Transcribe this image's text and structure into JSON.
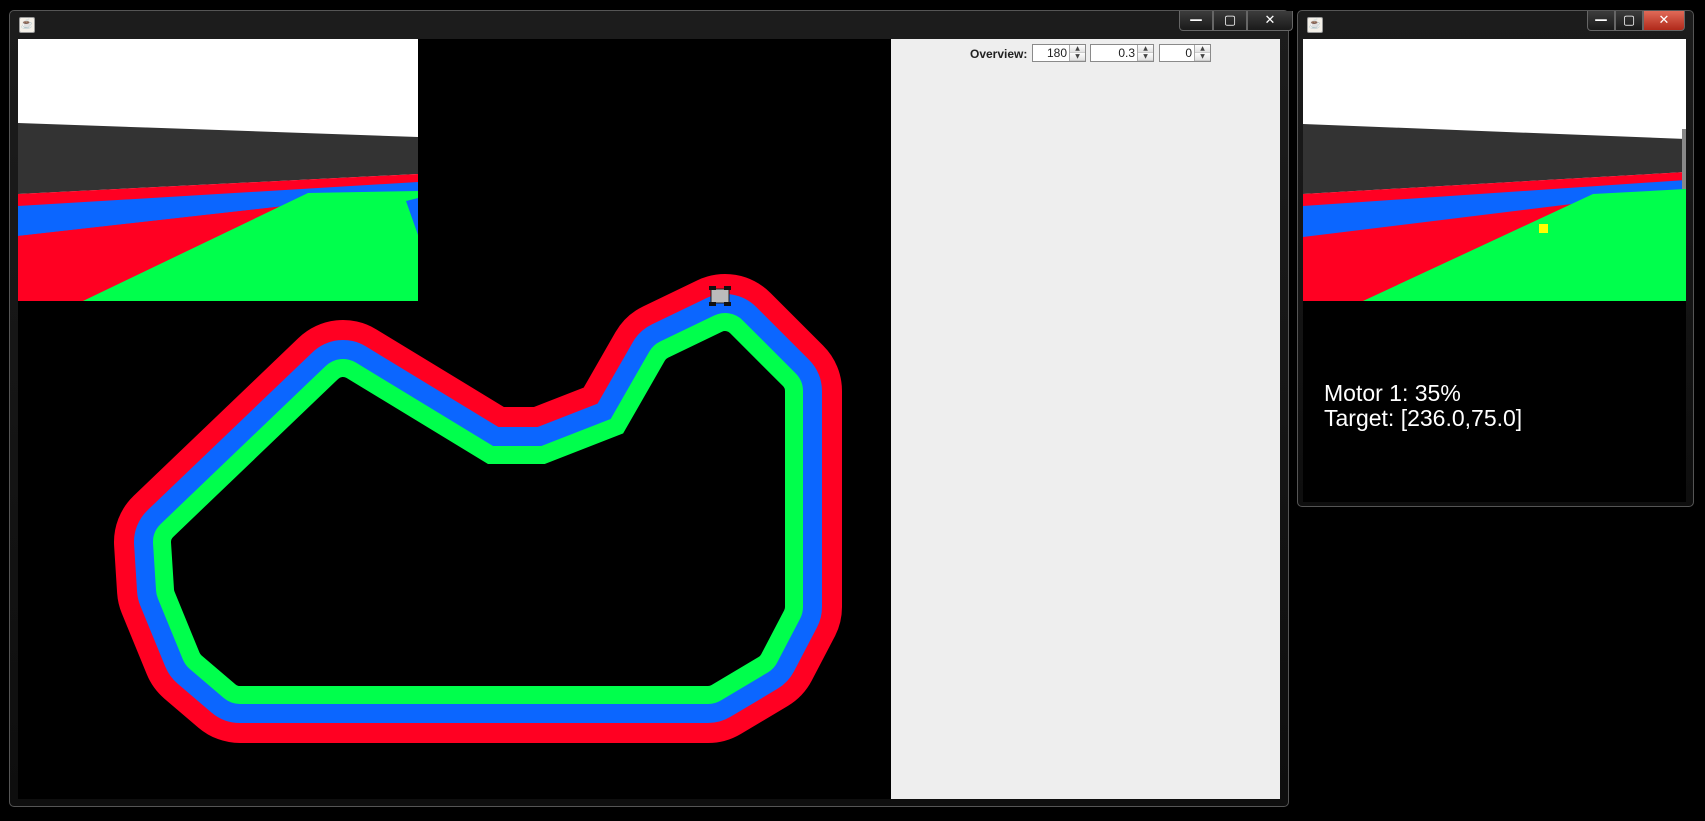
{
  "main_window": {
    "title": "",
    "controls": {
      "minimize": "—",
      "maximize": "▢",
      "close": "✕"
    },
    "overview": {
      "label": "Overview:",
      "spinners": [
        {
          "name": "angle",
          "value": "180"
        },
        {
          "name": "zoom",
          "value": "0.3"
        },
        {
          "name": "offset",
          "value": "0"
        }
      ]
    }
  },
  "side_window": {
    "title": "",
    "controls": {
      "minimize": "—",
      "maximize": "▢",
      "close": "✕"
    },
    "status": {
      "motor": "Motor 1: 35%",
      "target": "Target: [236.0,75.0]"
    }
  },
  "colors": {
    "track_outer": "#ff0022",
    "track_middle": "#0b66ff",
    "track_inner": "#00ff4c",
    "sky": "#ffffff",
    "wall": "#333333",
    "target_marker": "#ffff00",
    "panel": "#eeeeee"
  },
  "icons": {
    "app_icon": "java-icon",
    "robot": "robot-car-icon"
  }
}
